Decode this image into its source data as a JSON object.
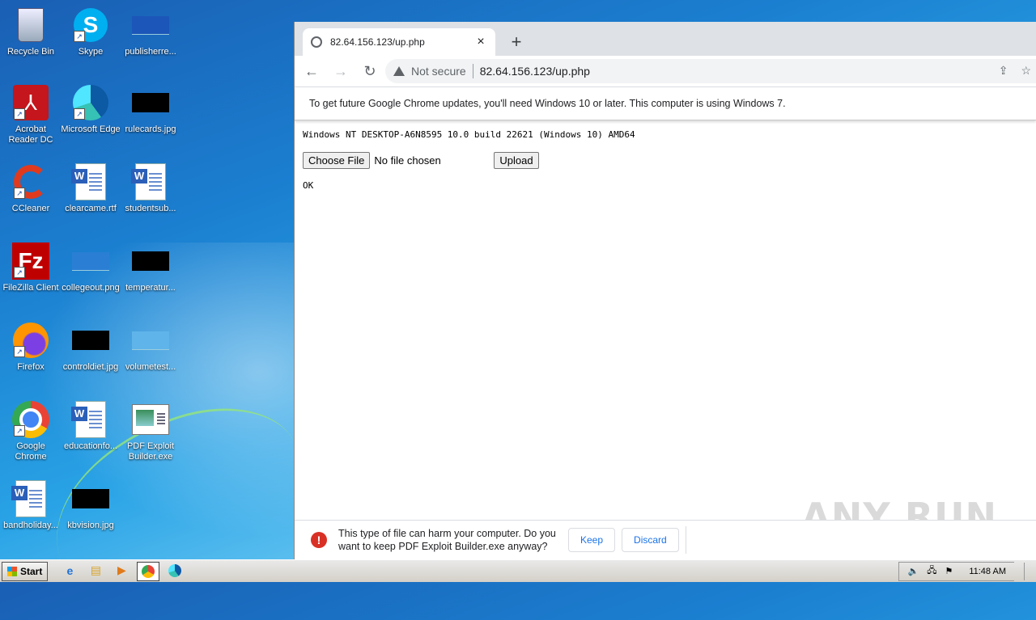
{
  "desktop": {
    "icons": [
      {
        "label": "Recycle Bin"
      },
      {
        "label": "Skype"
      },
      {
        "label": "publisherre..."
      },
      {
        "label": "Acrobat Reader DC"
      },
      {
        "label": "Microsoft Edge"
      },
      {
        "label": "rulecards.jpg"
      },
      {
        "label": "CCleaner"
      },
      {
        "label": "clearcame.rtf"
      },
      {
        "label": "studentsub..."
      },
      {
        "label": "FileZilla Client"
      },
      {
        "label": "collegeout.png"
      },
      {
        "label": "temperatur..."
      },
      {
        "label": "Firefox"
      },
      {
        "label": "controldiet.jpg"
      },
      {
        "label": "volumetest..."
      },
      {
        "label": "Google Chrome"
      },
      {
        "label": "educationfo..."
      },
      {
        "label": "PDF Exploit Builder.exe"
      },
      {
        "label": "bandholiday..."
      },
      {
        "label": "kbvision.jpg"
      }
    ]
  },
  "browser": {
    "tab_title": "82.64.156.123/up.php",
    "tab_close": "×",
    "new_tab": "+",
    "security_label": "Not secure",
    "url": "82.64.156.123/up.php",
    "infobar_text": "To get future Google Chrome updates, you'll need Windows 10 or later. This computer is using Windows 7."
  },
  "page": {
    "system_line": "Windows NT DESKTOP-A6N8595 10.0 build 22621 (Windows 10) AMD64",
    "choose_file_label": "Choose File",
    "no_file_text": "No file chosen",
    "upload_label": "Upload",
    "status_text": "OK"
  },
  "watermark": "ANY RUN",
  "download_bar": {
    "warning_text": "This type of file can harm your computer. Do you want to keep PDF Exploit Builder.exe anyway?",
    "keep_label": "Keep",
    "discard_label": "Discard"
  },
  "taskbar": {
    "start_label": "Start",
    "clock": "11:48 AM"
  },
  "colors": {
    "chrome_blue": "#1a73e8",
    "danger_red": "#d93025"
  }
}
